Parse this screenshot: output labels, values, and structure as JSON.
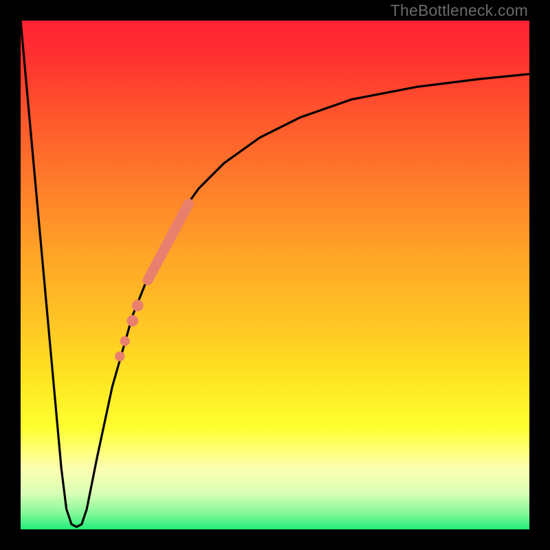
{
  "watermark": "TheBottleneck.com",
  "colors": {
    "frame": "#000000",
    "curve": "#000000",
    "markers": "#e9806e",
    "gradient_top": "#ff2135",
    "gradient_mid": "#ffe321",
    "gradient_bottom": "#1fed7a"
  },
  "chart_data": {
    "type": "line",
    "title": "",
    "xlabel": "",
    "ylabel": "",
    "xlim": [
      0,
      100
    ],
    "ylim": [
      0,
      100
    ],
    "grid": false,
    "legend": false,
    "note": "Generic bottleneck-style curve: steep descent from 100% to ~0% near x≈10, flat near 0 over x≈10–12, then asymptotic rise toward ~90% as x→100. Axis units not labeled in source; values are read off relative to plot bounds.",
    "series": [
      {
        "name": "bottleneck-curve",
        "x": [
          0,
          2,
          4,
          6,
          8,
          9,
          10,
          11,
          12,
          13,
          15,
          18,
          22,
          26,
          30,
          35,
          40,
          47,
          55,
          65,
          78,
          90,
          100
        ],
        "y": [
          100,
          78,
          56,
          34,
          12,
          4,
          1,
          0.5,
          1,
          4,
          14,
          28,
          42,
          52,
          60,
          67,
          72,
          77,
          81,
          84.5,
          87,
          88.5,
          89.5
        ]
      }
    ],
    "markers": {
      "name": "highlight-segment",
      "note": "Salmon dotted/bar markers along the rising part of the curve, roughly x≈20–33.",
      "points": [
        {
          "x": 19.5,
          "y": 34,
          "r": 1.2
        },
        {
          "x": 20.5,
          "y": 37,
          "r": 1.2
        },
        {
          "x": 22.0,
          "y": 41,
          "r": 1.4
        },
        {
          "x": 23.0,
          "y": 44,
          "r": 1.4
        },
        {
          "x": 25.0,
          "y": 49,
          "r": 2.1,
          "segment_end_x": 33.0,
          "segment_end_y": 64
        }
      ]
    }
  }
}
